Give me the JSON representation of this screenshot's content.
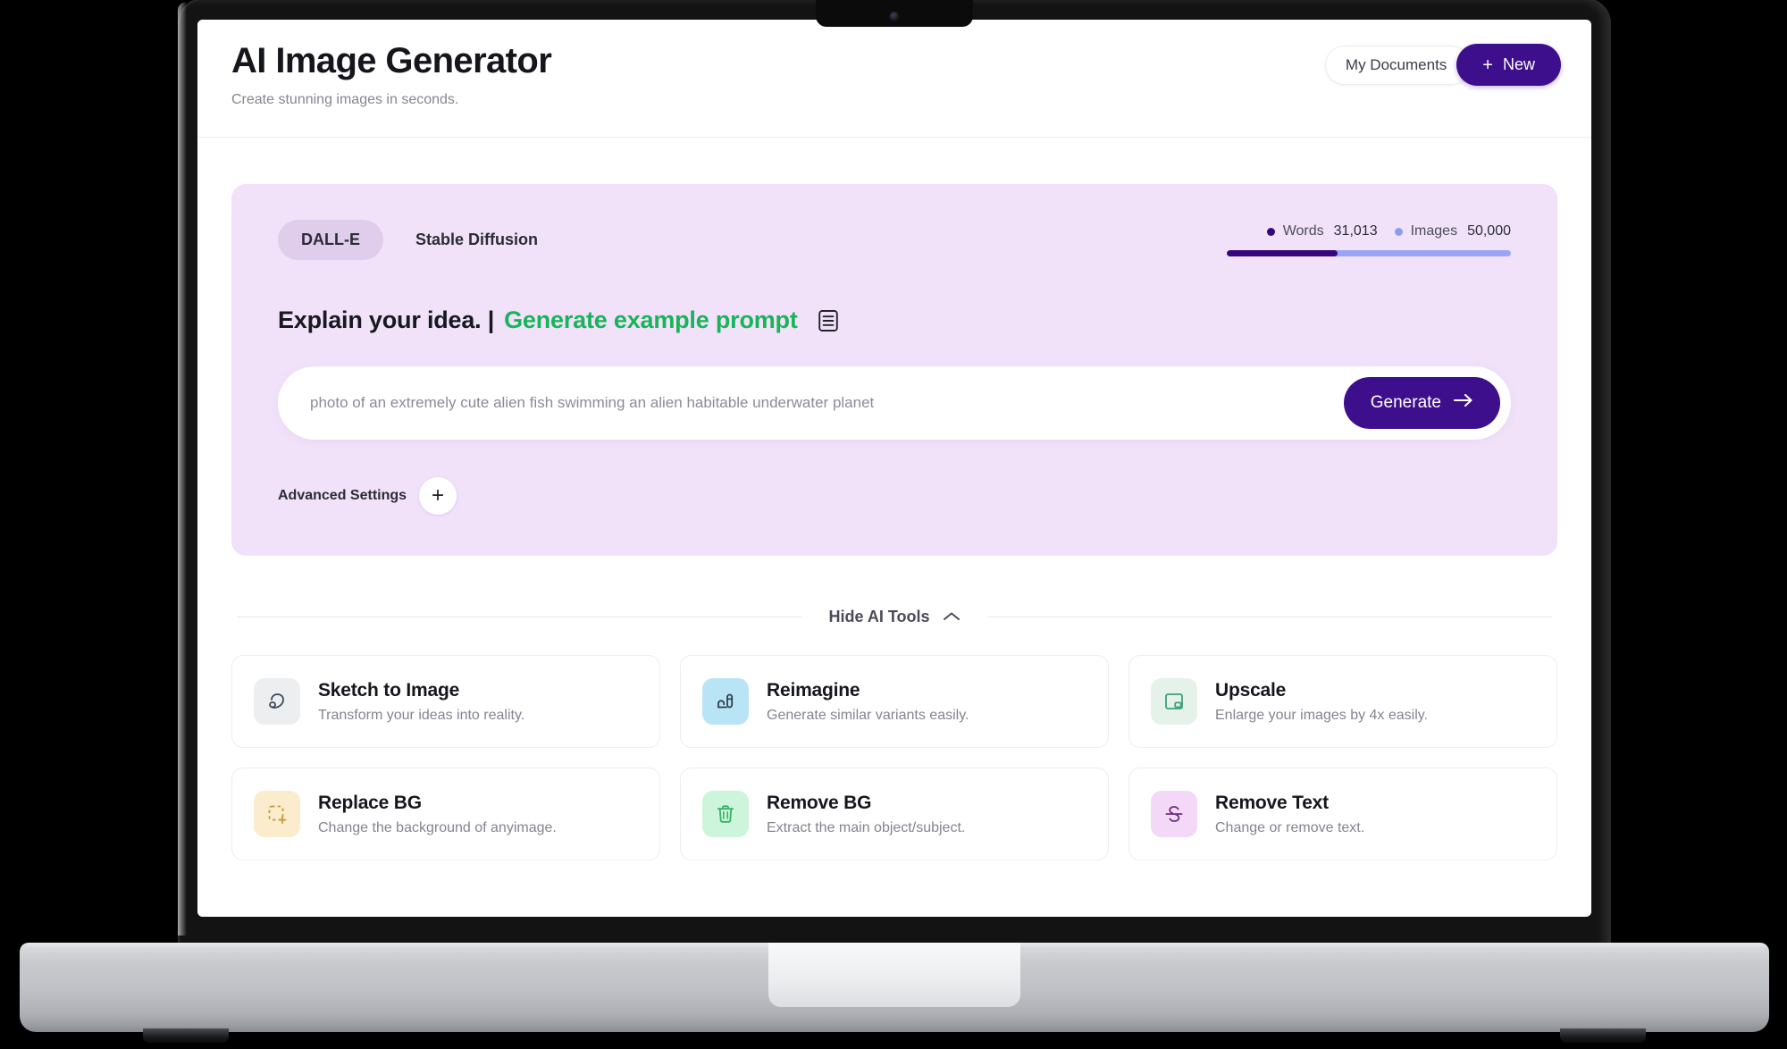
{
  "header": {
    "title": "AI Image Generator",
    "subtitle": "Create stunning images in seconds.",
    "my_documents_label": "My Documents",
    "new_label": "New",
    "new_plus": "+"
  },
  "generator": {
    "models": [
      {
        "label": "DALL-E",
        "active": true
      },
      {
        "label": "Stable Diffusion",
        "active": false
      }
    ],
    "usage": {
      "words_label": "Words",
      "words_value": "31,013",
      "images_label": "Images",
      "images_value": "50,000",
      "words_color": "#36067e",
      "images_color": "#8e9bf2",
      "words_percent": 39
    },
    "idea_static": "Explain your idea. |",
    "idea_link": "Generate example prompt",
    "prompt_placeholder": "photo of an extremely cute alien fish swimming an alien habitable underwater planet",
    "prompt_value": "",
    "generate_label": "Generate",
    "advanced_label": "Advanced Settings",
    "advanced_plus": "+"
  },
  "tools_section": {
    "toggle_label": "Hide AI Tools",
    "cards": [
      {
        "title": "Sketch to Image",
        "desc": "Transform your ideas into reality.",
        "tile": "#eceef0",
        "stroke": "#3d4a5c",
        "icon": "sketch-icon"
      },
      {
        "title": "Reimagine",
        "desc": "Generate similar variants easily.",
        "tile": "#b9e4f5",
        "stroke": "#2c3e4d",
        "icon": "reimagine-icon"
      },
      {
        "title": "Upscale",
        "desc": "Enlarge your images by 4x easily.",
        "tile": "#e4f2ea",
        "stroke": "#3fa07a",
        "icon": "upscale-icon"
      },
      {
        "title": "Replace BG",
        "desc": "Change the background of anyimage.",
        "tile": "#fbeccd",
        "stroke": "#c19a3a",
        "icon": "replace-bg-icon"
      },
      {
        "title": "Remove BG",
        "desc": "Extract the main object/subject.",
        "tile": "#cdf5db",
        "stroke": "#34b368",
        "icon": "remove-bg-icon"
      },
      {
        "title": "Remove Text",
        "desc": "Change or remove text.",
        "tile": "#f3d8f7",
        "stroke": "#6b2e82",
        "icon": "remove-text-icon"
      }
    ]
  },
  "theme": {
    "accent_purple": "#3e0f8c",
    "panel_bg": "#f1e2fa",
    "link_green": "#19b45a"
  }
}
